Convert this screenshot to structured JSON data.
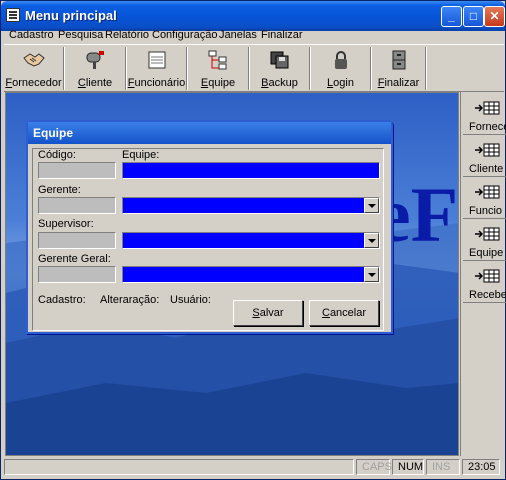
{
  "window": {
    "title": "Menu principal"
  },
  "menu": [
    "Cadastro",
    "Pesquisa",
    "Relatório",
    "Configuração",
    "Janelas",
    "Finalizar"
  ],
  "toolbar": [
    "Fornecedor",
    "Cliente",
    "Funcionário",
    "Equipe",
    "Backup",
    "Login",
    "Finalizar"
  ],
  "sidebar": [
    "Fornece",
    "Cliente",
    "Funcio",
    "Equipe",
    "Receber"
  ],
  "background_text": "eF",
  "dialog": {
    "title": "Equipe",
    "codigo_label": "Código:",
    "equipe_label": "Equipe:",
    "gerente_label": "Gerente:",
    "supervisor_label": "Supervisor:",
    "gerente_geral_label": "Gerente Geral:",
    "cadastro_label": "Cadastro:",
    "alteracao_label": "Alteraração:",
    "usuario_label": "Usuário:",
    "salvar": "Salvar",
    "cancelar": "Cancelar"
  },
  "status": {
    "caps": "CAPS",
    "num": "NUM",
    "ins": "INS",
    "time": "23:05"
  },
  "colors": {
    "title_blue": "#0854d9",
    "field_blue": "#0000ff",
    "field_gray": "#bdbdbd"
  }
}
